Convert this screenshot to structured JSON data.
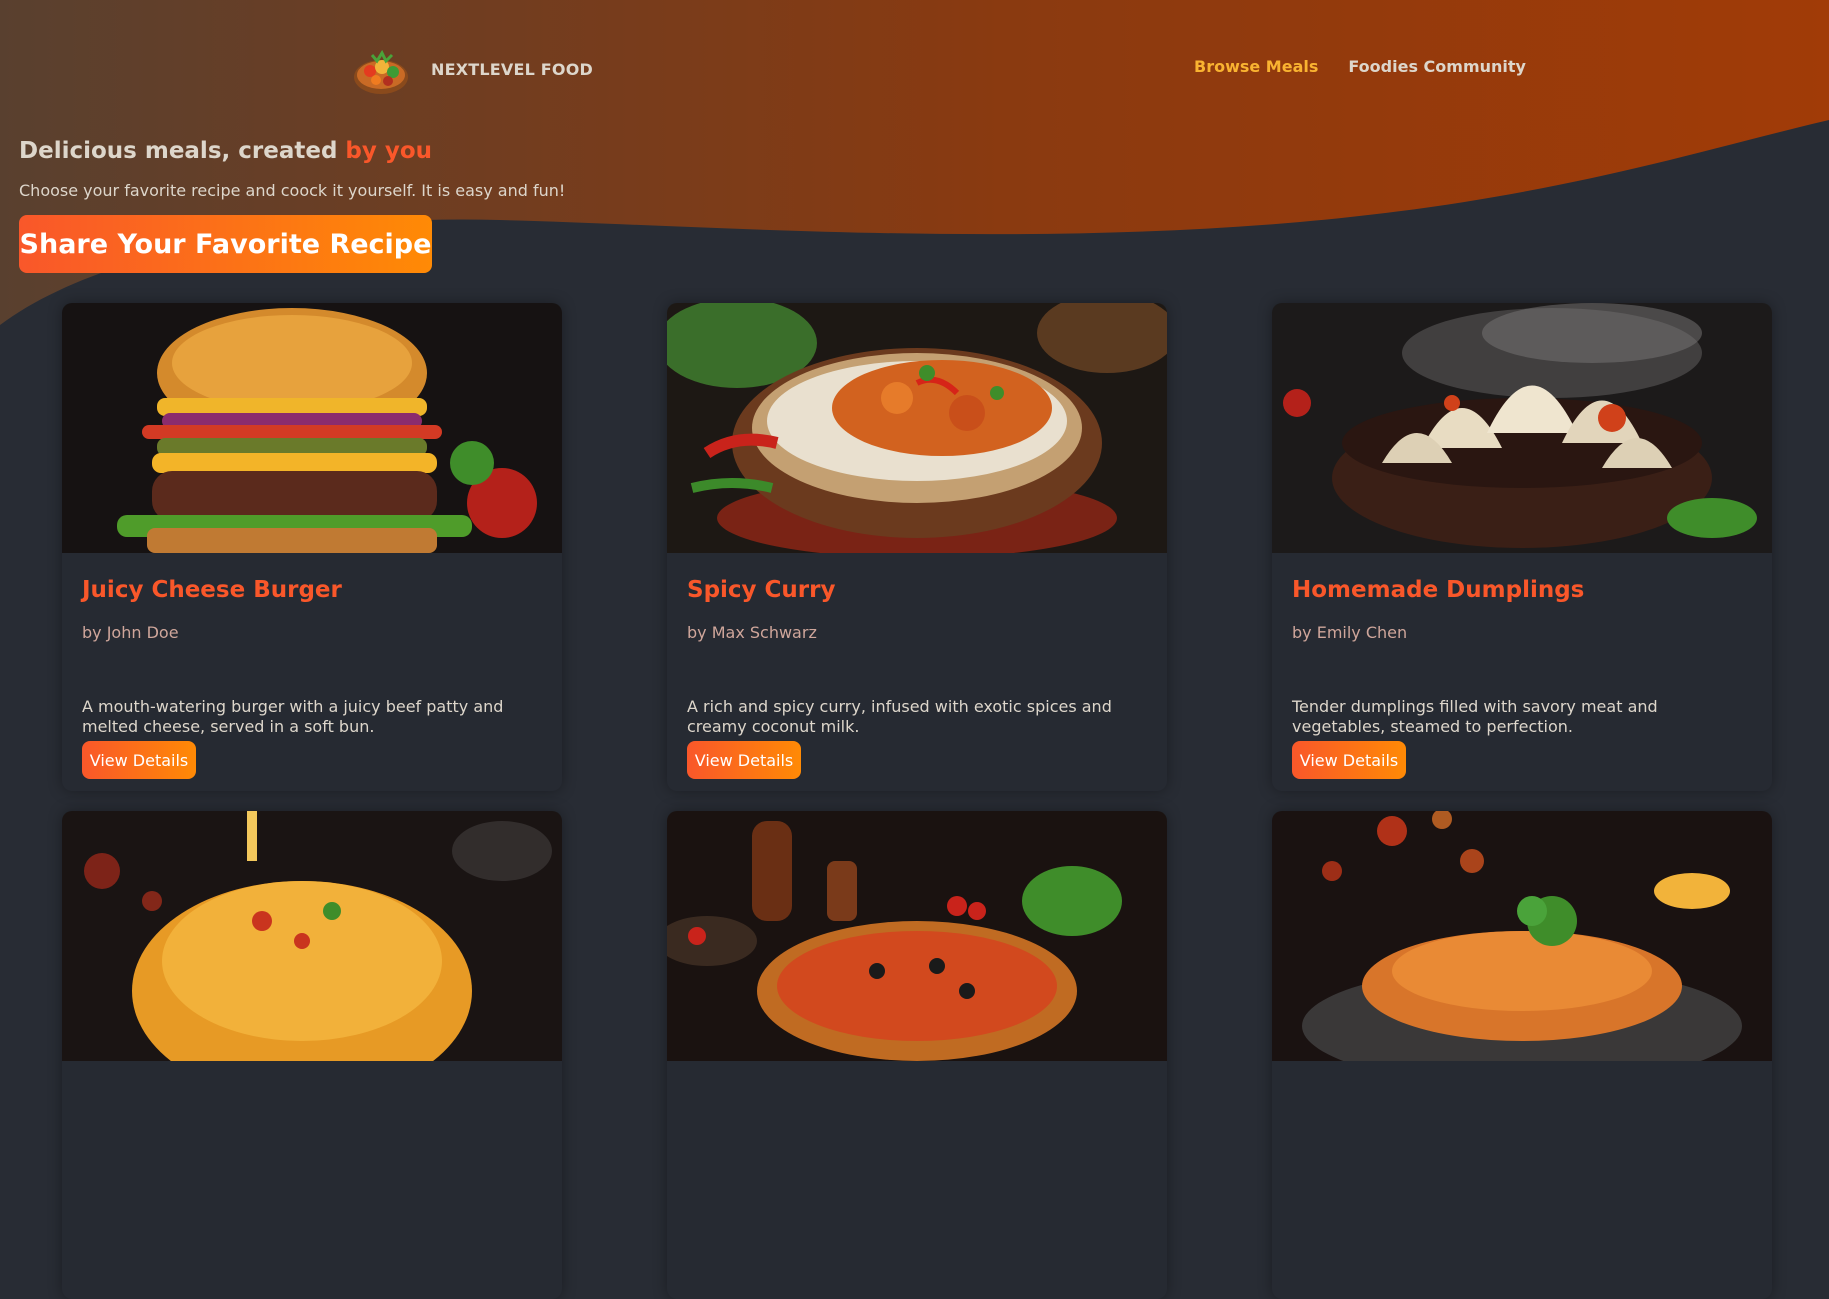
{
  "header": {
    "logo_text": "NEXTLEVEL FOOD",
    "nav": [
      {
        "label": "Browse Meals",
        "active": true
      },
      {
        "label": "Foodies Community",
        "active": false
      }
    ]
  },
  "hero": {
    "title_prefix": "Delicious meals, created ",
    "title_highlight": "by you",
    "subtitle": "Choose your favorite recipe and coock it yourself. It is easy and fun!",
    "share_label": "Share Your Favorite Recipe"
  },
  "meals": [
    {
      "title": "Juicy Cheese Burger",
      "creator": "by John Doe",
      "summary": "A mouth-watering burger with a juicy beef patty and melted cheese, served in a soft bun.",
      "button": "View Details",
      "image": "burger"
    },
    {
      "title": "Spicy Curry",
      "creator": "by Max Schwarz",
      "summary": "A rich and spicy curry, infused with exotic spices and creamy coconut milk.",
      "button": "View Details",
      "image": "curry"
    },
    {
      "title": "Homemade Dumplings",
      "creator": "by Emily Chen",
      "summary": "Tender dumplings filled with savory meat and vegetables, steamed to perfection.",
      "button": "View Details",
      "image": "dumplings"
    },
    {
      "image": "macaroni"
    },
    {
      "image": "pizza"
    },
    {
      "image": "schnitzel"
    }
  ],
  "colors": {
    "background": "#282c34",
    "accent": "#f9572a",
    "accent_2": "#ff8a05",
    "nav_active": "#f9b331",
    "text": "#ddd6cb"
  }
}
